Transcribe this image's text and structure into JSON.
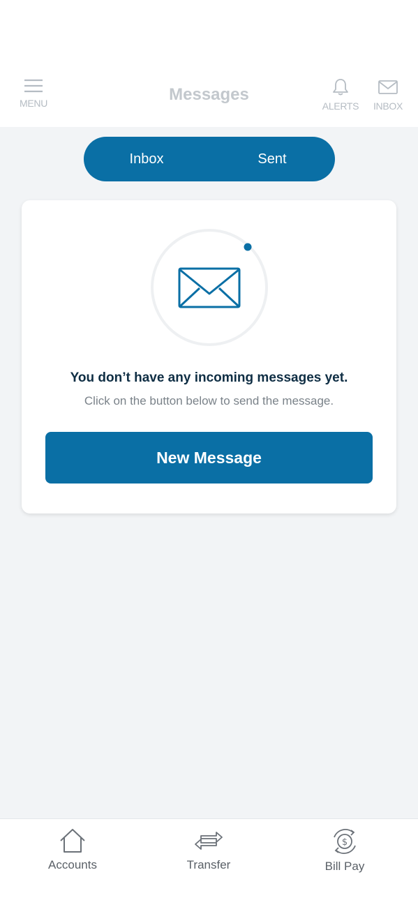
{
  "header": {
    "title": "Messages",
    "menu_label": "MENU",
    "alerts_label": "ALERTS",
    "inbox_label": "INBOX",
    "menu_icon": "hamburger-icon",
    "alerts_icon": "bell-icon",
    "inbox_icon": "envelope-icon"
  },
  "segmented": {
    "items": [
      {
        "label": "Inbox"
      },
      {
        "label": "Sent"
      }
    ]
  },
  "empty_state": {
    "icon": "envelope-icon",
    "title": "You don’t have any incoming messages yet.",
    "subtitle": "Click on the button below to send the message.",
    "button_label": "New Message"
  },
  "tabbar": {
    "items": [
      {
        "label": "Accounts",
        "icon": "home-icon"
      },
      {
        "label": "Transfer",
        "icon": "transfer-arrows-icon"
      },
      {
        "label": "Bill Pay",
        "icon": "bill-pay-icon"
      }
    ]
  },
  "colors": {
    "accent": "#0a6fa5",
    "background": "#f2f4f6",
    "title_text": "#0f2e44",
    "muted_text": "#7a8289",
    "header_gray": "#c3c8cd"
  }
}
